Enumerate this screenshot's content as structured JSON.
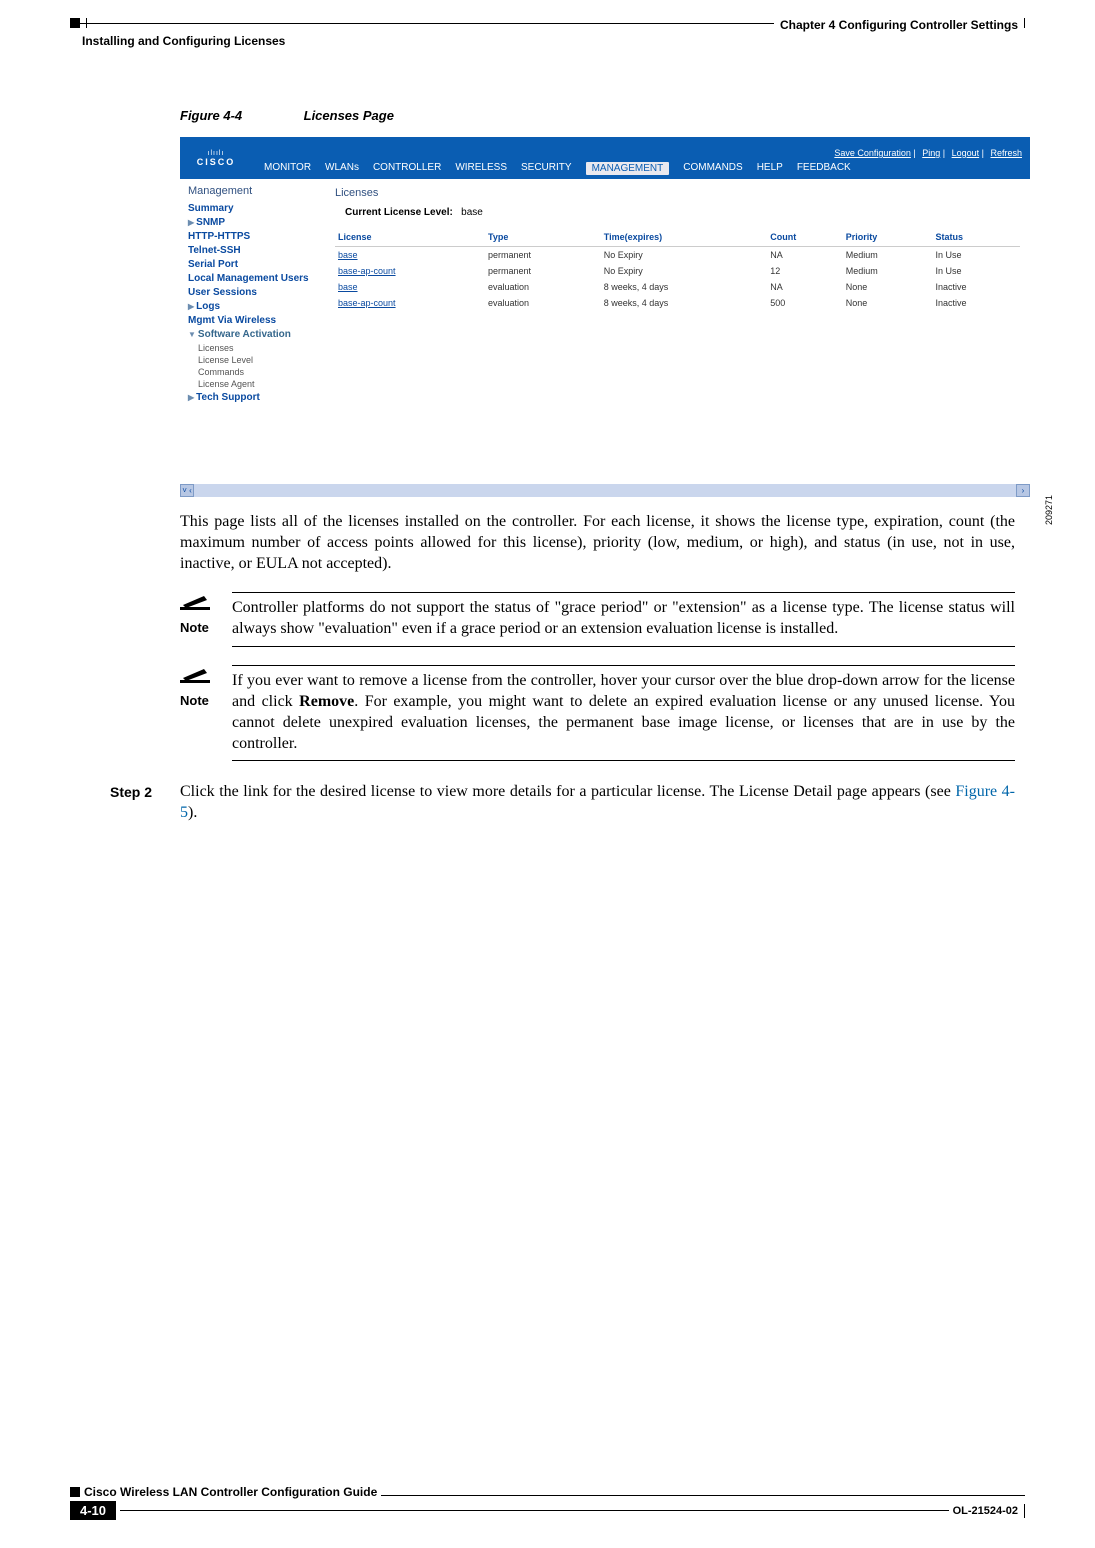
{
  "header": {
    "chapter": "Chapter 4      Configuring Controller Settings",
    "section": "Installing and Configuring Licenses"
  },
  "figure": {
    "number": "Figure 4-4",
    "title": "Licenses Page",
    "sideId": "209271"
  },
  "app": {
    "logoTop": "ılıılı",
    "logoBottom": "CISCO",
    "utilLinks": [
      "Save Configuration",
      "Ping",
      "Logout",
      "Refresh"
    ],
    "tabs": [
      "MONITOR",
      "WLANs",
      "CONTROLLER",
      "WIRELESS",
      "SECURITY",
      "MANAGEMENT",
      "COMMANDS",
      "HELP",
      "FEEDBACK"
    ],
    "activeTab": "MANAGEMENT",
    "sidebarTitle": "Management",
    "sidebar": [
      {
        "label": "Summary",
        "type": "item"
      },
      {
        "label": "SNMP",
        "type": "expand"
      },
      {
        "label": "HTTP-HTTPS",
        "type": "item"
      },
      {
        "label": "Telnet-SSH",
        "type": "item"
      },
      {
        "label": "Serial Port",
        "type": "item"
      },
      {
        "label": "Local Management Users",
        "type": "item"
      },
      {
        "label": "User Sessions",
        "type": "item"
      },
      {
        "label": "Logs",
        "type": "expand"
      },
      {
        "label": "Mgmt Via Wireless",
        "type": "item"
      },
      {
        "label": "Software Activation",
        "type": "open",
        "subs": [
          "Licenses",
          "License Level",
          "Commands",
          "License Agent"
        ]
      },
      {
        "label": "Tech Support",
        "type": "expand"
      }
    ],
    "mainTitle": "Licenses",
    "currentLevelLabel": "Current License Level:",
    "currentLevelValue": "base",
    "columns": [
      "License",
      "Type",
      "Time(expires)",
      "Count",
      "Priority",
      "Status"
    ],
    "rows": [
      {
        "license": "base",
        "type": "permanent",
        "time": "No Expiry",
        "count": "NA",
        "priority": "Medium",
        "status": "In Use"
      },
      {
        "license": "base-ap-count",
        "type": "permanent",
        "time": "No Expiry",
        "count": "12",
        "priority": "Medium",
        "status": "In Use"
      },
      {
        "license": "base",
        "type": "evaluation",
        "time": "8 weeks, 4 days",
        "count": "NA",
        "priority": "None",
        "status": "Inactive"
      },
      {
        "license": "base-ap-count",
        "type": "evaluation",
        "time": "8 weeks, 4 days",
        "count": "500",
        "priority": "None",
        "status": "Inactive"
      }
    ]
  },
  "para1": "This page lists all of the licenses installed on the controller. For each license, it shows the license type, expiration, count (the maximum number of access points allowed for this license), priority (low, medium, or high), and status (in use, not in use, inactive, or EULA not accepted).",
  "note1": {
    "label": "Note",
    "text": "Controller platforms do not support the status of \"grace period\" or \"extension\" as a license type. The license status will always show \"evaluation\" even if a grace period or an extension evaluation license is installed."
  },
  "note2": {
    "label": "Note",
    "text_a": "If you ever want to remove a license from the controller, hover your cursor over the blue drop-down arrow for the license and click ",
    "text_bold": "Remove",
    "text_b": ". For example, you might want to delete an expired evaluation license or any unused license. You cannot delete unexpired evaluation licenses, the permanent base image license, or licenses that are in use by the controller."
  },
  "step2": {
    "label": "Step 2",
    "text_a": "Click the link for the desired license to view more details for a particular license. The License Detail page appears (see ",
    "xref": "Figure 4-5",
    "text_b": ")."
  },
  "footer": {
    "title": "Cisco Wireless LAN Controller Configuration Guide",
    "page": "4-10",
    "docId": "OL-21524-02"
  }
}
